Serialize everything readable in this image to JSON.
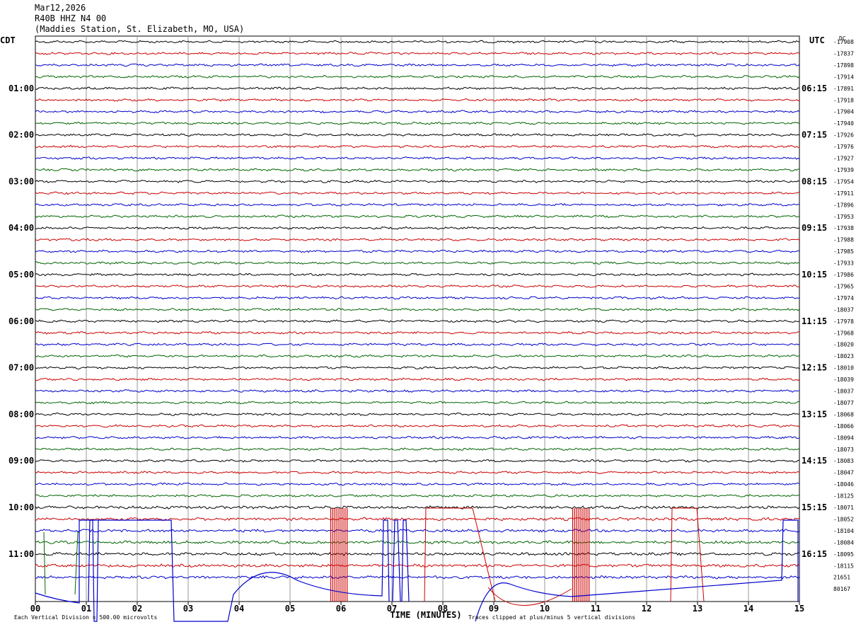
{
  "header": {
    "date": "Mar12,2026",
    "channel": "R40B HHZ N4 00",
    "station": "(Maddies Station, St. Elizabeth, MO, USA)"
  },
  "chart_data": {
    "type": "line",
    "title": "",
    "left_tz_label": "CDT",
    "right_tz_label": "UTC",
    "offset_header": "DC",
    "xlabel": "TIME (MINUTES)",
    "xlim": [
      0,
      15
    ],
    "x_ticks": [
      "00",
      "01",
      "02",
      "03",
      "04",
      "05",
      "06",
      "07",
      "08",
      "09",
      "10",
      "11",
      "12",
      "13",
      "14",
      "15"
    ],
    "left_hour_labels": [
      "01:00",
      "02:00",
      "03:00",
      "04:00",
      "05:00",
      "06:00",
      "07:00",
      "08:00",
      "09:00",
      "10:00",
      "11:00"
    ],
    "right_hour_labels": [
      "06:15",
      "07:15",
      "08:15",
      "09:15",
      "10:15",
      "11:15",
      "12:15",
      "13:15",
      "14:15",
      "15:15",
      "16:15"
    ],
    "trace_colors": [
      "#000000",
      "#cc0000",
      "#0000cc",
      "#006600"
    ],
    "trace_count": 47,
    "dc_offsets": [
      "-17908",
      "-17837",
      "-17898",
      "-17914",
      "-17891",
      "-17918",
      "-17904",
      "-17940",
      "-17926",
      "-17976",
      "-17927",
      "-17939",
      "-17954",
      "-17911",
      "-17896",
      "-17953",
      "-17938",
      "-17988",
      "-17985",
      "-17933",
      "-17986",
      "-17965",
      "-17974",
      "-18037",
      "-17978",
      "-17968",
      "-18020",
      "-18023",
      "-18010",
      "-18039",
      "-18037",
      "-18077",
      "-18068",
      "-18066",
      "-18094",
      "-18073",
      "-18083",
      "-18047",
      "-18046",
      "-18125",
      "-18071",
      "-18052",
      "-18104",
      "-18084",
      "-18095",
      "-18115",
      "21651",
      "80167"
    ],
    "footer_left": "Each Vertical Division = 500.00 microvolts",
    "footer_right": "Traces clipped at plus/minus 5 vertical divisions",
    "grid": true
  }
}
